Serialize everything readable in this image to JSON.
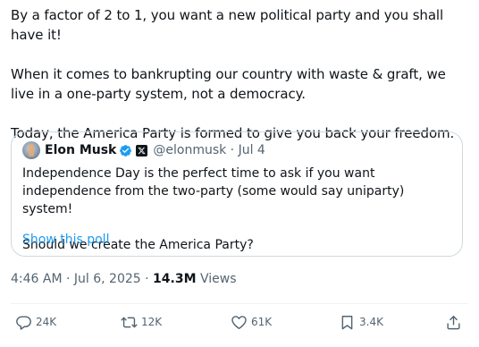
{
  "post": {
    "paragraphs": [
      "By a factor of 2 to 1, you want a new political party and you shall have it!",
      "When it comes to bankrupting our country with waste & graft, we live in a one-party system, not a democracy.",
      "Today, the America Party is formed to give you back your freedom."
    ]
  },
  "quote": {
    "name": "Elon Musk",
    "handle_line": "@elonmusk · Jul 4",
    "paragraphs": [
      "Independence Day is the perfect time to ask if you want independence from the two-party (some would say uniparty) system!",
      "Should we create the America Party?"
    ],
    "poll_link": "Show this poll"
  },
  "meta": {
    "timestamp": "4:46 AM · Jul 6, 2025 · ",
    "views_count": "14.3M",
    "views_label": " Views"
  },
  "actions": {
    "replies": "24K",
    "reposts": "12K",
    "likes": "61K",
    "bookmarks": "3.4K"
  },
  "colors": {
    "text": "#0f1419",
    "secondary": "#536471",
    "link": "#1d9bf0",
    "border": "#cfd9de"
  },
  "icons": {
    "verified": "verified-badge-icon",
    "affiliate": "x-logo-icon",
    "reply": "reply-icon",
    "repost": "repost-icon",
    "like": "heart-icon",
    "bookmark": "bookmark-icon",
    "share": "share-icon"
  }
}
